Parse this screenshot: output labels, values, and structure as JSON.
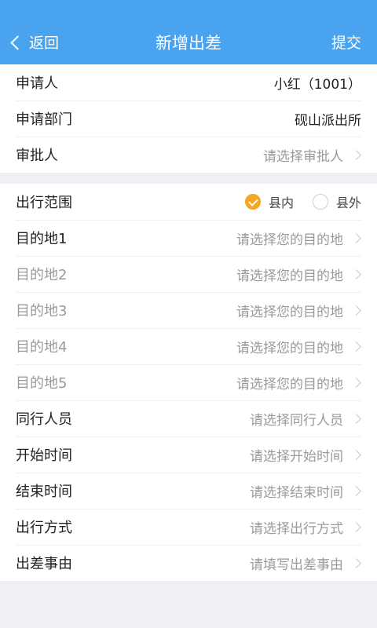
{
  "header": {
    "back_label": "返回",
    "title": "新增出差",
    "submit_label": "提交"
  },
  "info": {
    "applicant": {
      "label": "申请人",
      "value": "小红（1001）"
    },
    "department": {
      "label": "申请部门",
      "value": "砚山派出所"
    },
    "approver": {
      "label": "审批人",
      "placeholder": "请选择审批人"
    }
  },
  "form": {
    "scope": {
      "label": "出行范围",
      "options": [
        {
          "label": "县内",
          "checked": true
        },
        {
          "label": "县外",
          "checked": false
        }
      ]
    },
    "destinations": [
      {
        "label": "目的地1",
        "placeholder": "请选择您的目的地"
      },
      {
        "label": "目的地2",
        "placeholder": "请选择您的目的地"
      },
      {
        "label": "目的地3",
        "placeholder": "请选择您的目的地"
      },
      {
        "label": "目的地4",
        "placeholder": "请选择您的目的地"
      },
      {
        "label": "目的地5",
        "placeholder": "请选择您的目的地"
      }
    ],
    "companions": {
      "label": "同行人员",
      "placeholder": "请选择同行人员"
    },
    "start_time": {
      "label": "开始时间",
      "placeholder": "请选择开始时间"
    },
    "end_time": {
      "label": "结束时间",
      "placeholder": "请选择结束时间"
    },
    "travel_mode": {
      "label": "出行方式",
      "placeholder": "请选择出行方式"
    },
    "reason": {
      "label": "出差事由",
      "placeholder": "请填写出差事由"
    }
  },
  "colors": {
    "header_bg": "#4aa3ef",
    "radio_checked": "#f5a623"
  }
}
